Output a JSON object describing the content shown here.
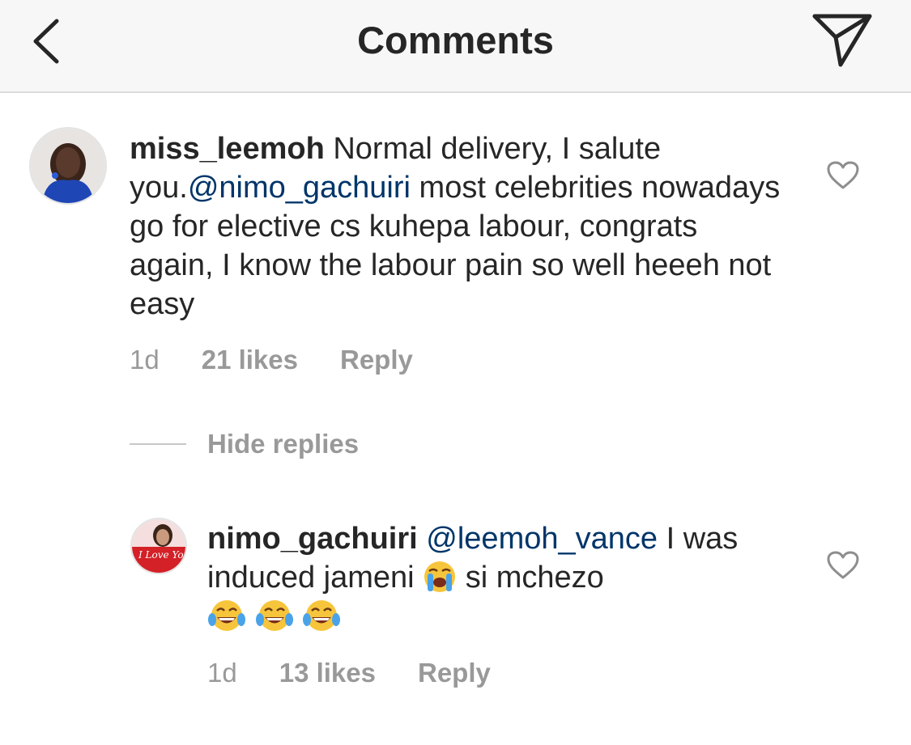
{
  "header": {
    "title": "Comments",
    "back_icon": "chevron-left-icon",
    "share_icon": "paper-plane-icon"
  },
  "comments": [
    {
      "username": "miss_leemoh",
      "text_before_mention": " Normal delivery, I salute you.",
      "mention": "@nimo_gachuiri",
      "text_after_mention": "  most celebrities nowadays go for elective cs kuhepa labour, congrats again, I know the labour pain so well heeeh not easy",
      "time": "1d",
      "likes": "21 likes",
      "reply": "Reply"
    }
  ],
  "hide_replies": "Hide replies",
  "replies": [
    {
      "username": "nimo_gachuiri",
      "mention": "@leemoh_vance",
      "text_part1": " I was induced jameni ",
      "emoji_1": "loudly-crying-face",
      "text_part2": " si mchezo",
      "emoji_2": "face-with-tears-of-joy",
      "avatar_text": "I Love You",
      "time": "1d",
      "likes": "13 likes",
      "reply": "Reply"
    }
  ],
  "colors": {
    "mention": "#003569",
    "meta": "#999999",
    "header_bg": "#f7f7f7"
  }
}
